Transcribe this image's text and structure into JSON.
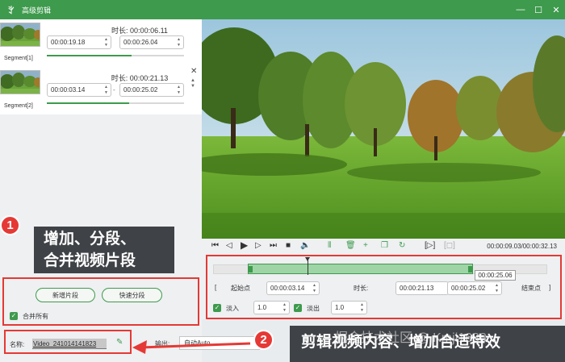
{
  "window": {
    "title": "高级剪辑",
    "logo_glyph": "ꇬ",
    "min_glyph": "—",
    "max_glyph": "☐",
    "close_glyph": "✕"
  },
  "segments": [
    {
      "name": "Segment[1]",
      "duration": "时长:  00:00:06.11",
      "start": "00:00:19.18",
      "end": "00:00:26.04",
      "progress": 0.62
    },
    {
      "name": "Segment[2]",
      "duration": "时长:  00:00:21.13",
      "start": "00:00:03.14",
      "end": "00:00:25.02",
      "progress": 0.6
    }
  ],
  "callout1": {
    "badge": "1",
    "line1": "增加、分段、",
    "line2": "合并视频片段"
  },
  "segment_buttons": {
    "add_label": "新增片段",
    "quick_split_label": "快速分段",
    "merge_all_label": "合并所有"
  },
  "name": {
    "label": "名称:",
    "value": "Video_241014141823",
    "edit_glyph": "✎"
  },
  "output": {
    "label": "输出:",
    "value": "自动Auto"
  },
  "player": {
    "time_info": "00:00:09.03/00:00:32.13"
  },
  "timeline": {
    "tooltip": "00:00:25.06",
    "start_label": "起始点",
    "start_value": "00:00:03.14",
    "duration_label": "时长:",
    "duration_value": "00:00:21.13",
    "end_value": "00:00:25.02",
    "end_label": "结束点",
    "fade_in_label": "淡入",
    "fade_in_value": "1.0",
    "fade_out_label": "淡出",
    "fade_out_value": "1.0",
    "check_glyph": "✓"
  },
  "callout2": {
    "badge": "2",
    "text": "剪辑视频内容、增加合适特效",
    "watermark": "掘金技术社区 @ Kmji1688"
  },
  "colors": {
    "accent": "#3e9a4d",
    "callout": "#3f4246",
    "highlight": "#e53935"
  }
}
